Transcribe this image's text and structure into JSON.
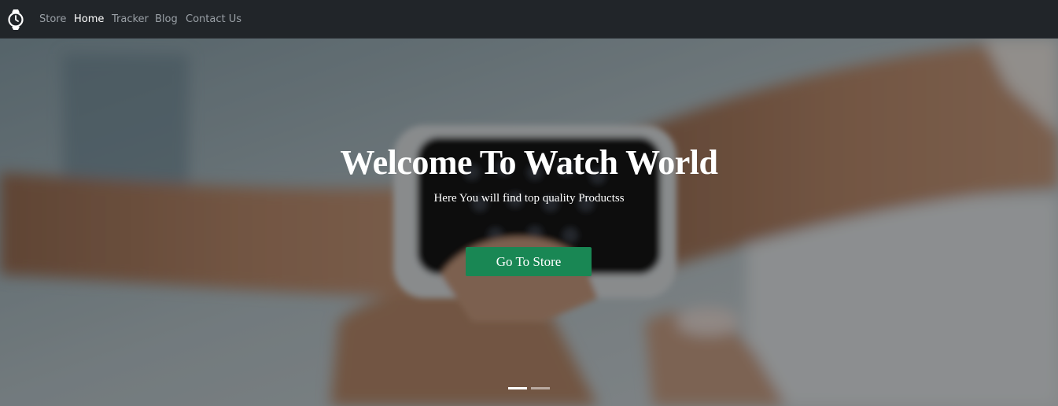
{
  "nav": {
    "brand_icon": "watch-icon",
    "items": [
      {
        "label": "Store",
        "active": false
      },
      {
        "label": "Home",
        "active": true
      },
      {
        "label": "Tracker",
        "active": false
      },
      {
        "label": "Blog",
        "active": false
      },
      {
        "label": "Contact Us",
        "active": false
      }
    ]
  },
  "hero": {
    "title": "Welcome To Watch World",
    "subtitle": "Here You will find top quality Productss",
    "cta_label": "Go To Store",
    "cta_color": "#198754",
    "slides_count": 2,
    "active_slide": 1
  },
  "colors": {
    "navbar": "#212529",
    "nav_text": "#9aa0a6",
    "nav_active": "#ffffff"
  }
}
